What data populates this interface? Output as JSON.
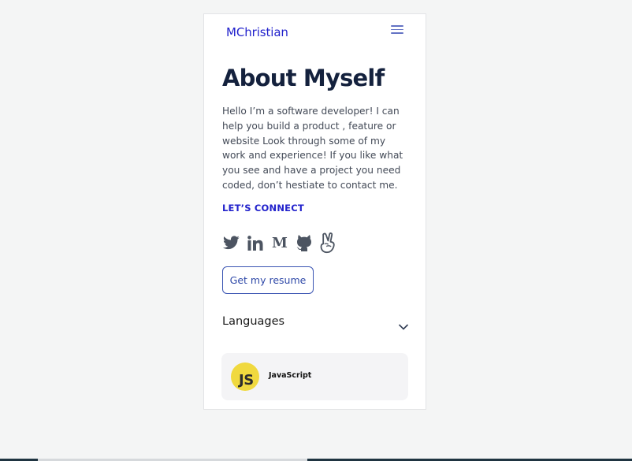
{
  "header": {
    "brand": "MChristian",
    "menu_icon": "hamburger-menu-icon"
  },
  "about": {
    "title": "About Myself",
    "bio": "Hello I’m a software developer! I can help you build a product , feature or website Look through some of my work and experience! If you like what you see and have a project you need coded, don’t hestiate to contact me.",
    "connect_label": "LET’S CONNECT"
  },
  "socials": [
    {
      "icon": "twitter-icon"
    },
    {
      "icon": "linkedin-icon"
    },
    {
      "icon": "medium-icon"
    },
    {
      "icon": "github-icon"
    },
    {
      "icon": "angellist-icon"
    }
  ],
  "resume_button": "Get my resume",
  "languages": {
    "heading": "Languages",
    "items": [
      {
        "logo_text": "JS",
        "name": "JavaScript"
      }
    ]
  },
  "colors": {
    "brand": "#2222cc",
    "title": "#14213d",
    "icon": "#4c5461",
    "js_yellow": "#f0d93f"
  }
}
